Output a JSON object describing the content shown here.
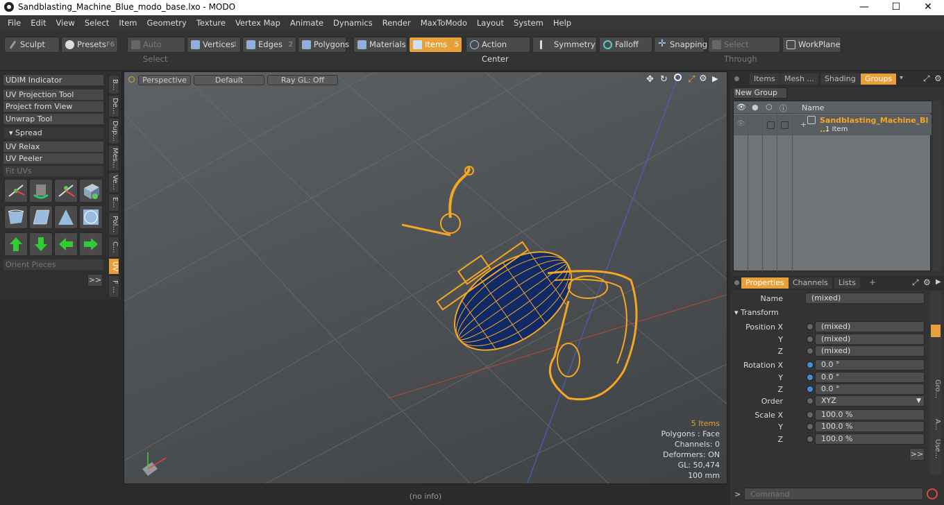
{
  "window": {
    "title": "Sandblasting_Machine_Blue_modo_base.lxo - MODO",
    "minimize": "—",
    "maximize": "☐",
    "close": "✕"
  },
  "menu": [
    "File",
    "Edit",
    "View",
    "Select",
    "Item",
    "Geometry",
    "Texture",
    "Vertex Map",
    "Animate",
    "Dynamics",
    "Render",
    "MaxToModo",
    "Layout",
    "System",
    "Help"
  ],
  "toolbar": {
    "sculpt": "Sculpt",
    "presets": "Presets",
    "presets_key": "F6",
    "auto_select": "Auto Select",
    "vertices": "Vertices",
    "vertices_key": "1",
    "edges": "Edges",
    "edges_key": "2",
    "polygons": "Polygons",
    "materials": "Materials",
    "items": "Items",
    "items_key": "5",
    "action_center": "Action Center",
    "symmetry": "Symmetry",
    "falloff": "Falloff",
    "snapping": "Snapping",
    "select_through": "Select Through",
    "workplane": "WorkPlane"
  },
  "left": {
    "buttons": [
      "UDIM Indicator",
      "UV Projection Tool",
      "Project from View",
      "Unwrap Tool"
    ],
    "spread": "Spread",
    "buttons2": [
      "UV Relax",
      "UV Peeler"
    ],
    "fit_uvs": "Fit UVs",
    "orient": "Orient Pieces",
    "more": ">>",
    "vtabs": [
      "B...",
      "De...",
      "Dup...",
      "Mes...",
      "Ve...",
      "E...",
      "Pol...",
      "C...",
      "UV",
      "F ..."
    ]
  },
  "viewport": {
    "perspective": "Perspective",
    "default": "Default",
    "raygl": "Ray GL: Off",
    "items_count": "5 Items",
    "polygons": "Polygons : Face",
    "channels": "Channels: 0",
    "deformers": "Deformers: ON",
    "gl": "GL: 50,474",
    "scale": "100 mm"
  },
  "status": "(no info)",
  "groups": {
    "tabs": [
      "Items",
      "Mesh ...",
      "Shading",
      "Groups"
    ],
    "new_group": "New Group",
    "col_name": "Name",
    "row_name": "Sandblasting_Machine_Bl ...",
    "row_sub": "1 Item"
  },
  "props": {
    "tabs": [
      "Properties",
      "Channels",
      "Lists"
    ],
    "add": "+",
    "name_label": "Name",
    "name_value": "(mixed)",
    "transform": "Transform",
    "position_label": "Position X",
    "rotation_label": "Rotation X",
    "scale_label": "Scale X",
    "y": "Y",
    "z": "Z",
    "pos": [
      "(mixed)",
      "(mixed)",
      "(mixed)"
    ],
    "rot": [
      "0.0 °",
      "0.0 °",
      "0.0 °"
    ],
    "order_label": "Order",
    "order_value": "XYZ",
    "scale": [
      "100.0 %",
      "100.0 %",
      "100.0 %"
    ],
    "more": ">>",
    "side_tabs": [
      "Gro...",
      "A...",
      "Use..."
    ]
  },
  "command": {
    "prompt": ">",
    "placeholder": "Command"
  },
  "colors": {
    "accent": "#e8a13a",
    "mesh_wire": "#f5a623",
    "mesh_fill": "#0f2a66"
  }
}
